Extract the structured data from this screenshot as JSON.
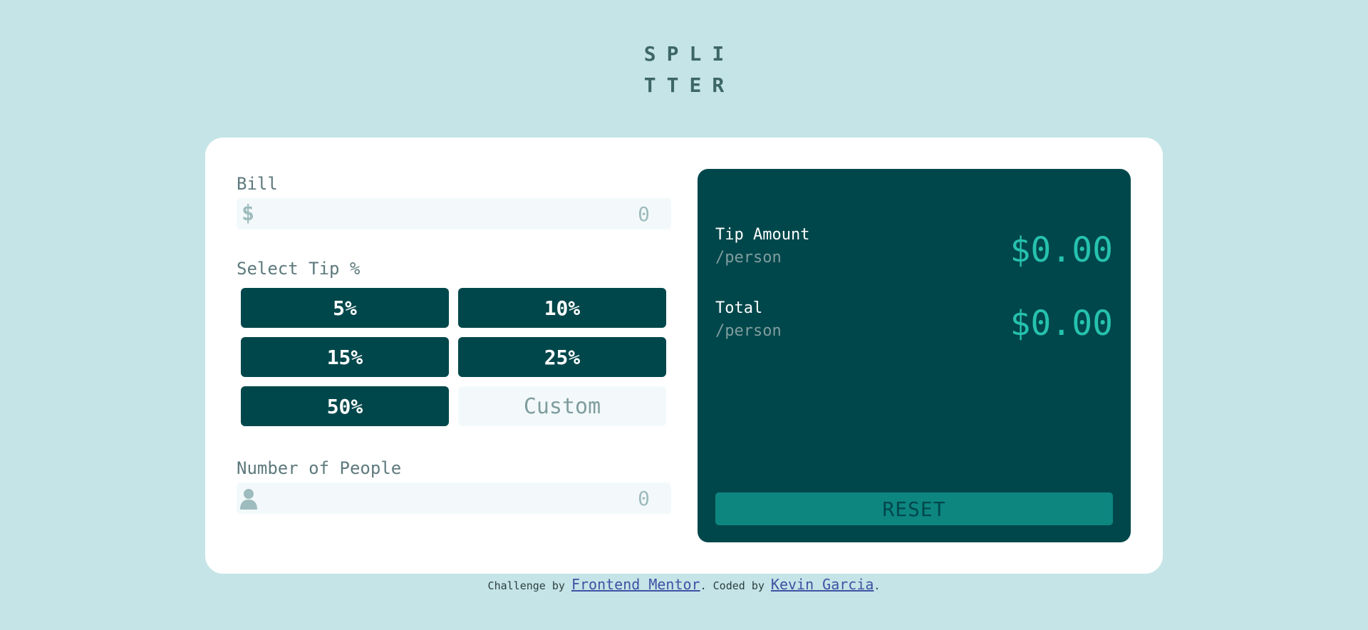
{
  "logo": {
    "line1": "SPLI",
    "line2": "TTER"
  },
  "bill": {
    "label": "Bill",
    "currency_symbol": "$",
    "placeholder": "0",
    "icon": "dollar-icon"
  },
  "tip": {
    "label": "Select Tip %",
    "options": [
      "5%",
      "10%",
      "15%",
      "25%",
      "50%"
    ],
    "custom_placeholder": "Custom"
  },
  "people": {
    "label": "Number of People",
    "placeholder": "0",
    "icon": "person-icon"
  },
  "results": {
    "tip_amount": {
      "label": "Tip Amount",
      "sub": "/person",
      "value": "$0.00"
    },
    "total": {
      "label": "Total",
      "sub": "/person",
      "value": "$0.00"
    },
    "reset_label": "RESET"
  },
  "footer": {
    "prefix": "Challenge by ",
    "link1": "Frontend Mentor",
    "middle": ". Coded by ",
    "link2": "Kevin Garcia",
    "suffix": "."
  },
  "colors": {
    "background": "#c5e4e7",
    "dark_cyan": "#00474b",
    "strong_cyan": "#26c2ae",
    "grayish_cyan": "#7f9d9f",
    "reset_bg": "#0d8680"
  }
}
